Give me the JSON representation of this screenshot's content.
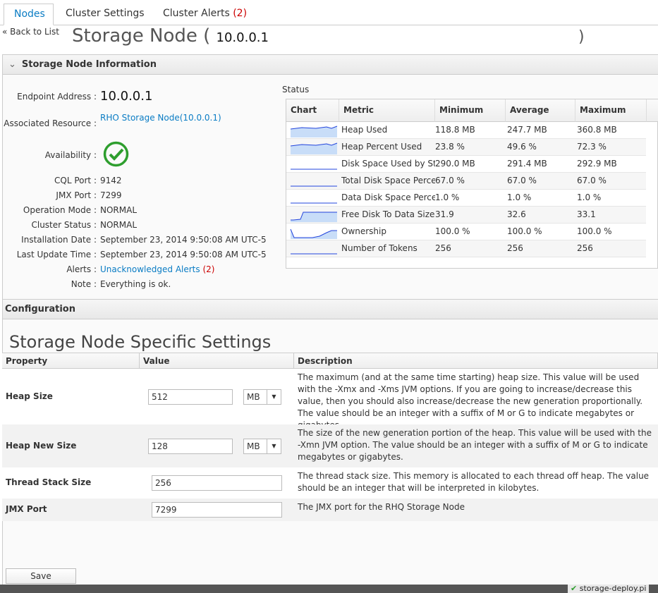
{
  "tabs": [
    {
      "label": "Nodes",
      "active": true
    },
    {
      "label": "Cluster Settings"
    },
    {
      "label": "Cluster Alerts",
      "count": "(2)"
    }
  ],
  "back_link": "« Back to List",
  "title": {
    "prefix": "Storage Node (",
    "address": "10.0.0.1",
    "suffix": ")"
  },
  "info_section": {
    "title": "Storage Node Information",
    "fields": {
      "endpoint_label": "Endpoint Address :",
      "endpoint": "10.0.0.1",
      "resource_label": "Associated Resource :",
      "resource": "RHO Storage Node(10.0.0.1)",
      "availability_label": "Availability :",
      "availability_icon": "check-circle-icon",
      "cql_label": "CQL Port :",
      "cql": "9142",
      "jmx_label": "JMX Port :",
      "jmx": "7299",
      "opmode_label": "Operation Mode :",
      "opmode": "NORMAL",
      "cstatus_label": "Cluster Status :",
      "cstatus": "NORMAL",
      "install_label": "Installation Date :",
      "install": "September 23, 2014 9:50:08 AM UTC-5",
      "update_label": "Last Update Time :",
      "update": "September 23, 2014 9:50:08 AM UTC-5",
      "alerts_label": "Alerts :",
      "alerts": "Unacknowledged Alerts",
      "alerts_count": "(2)",
      "note_label": "Note :",
      "note": "Everything is ok."
    }
  },
  "status": {
    "label": "Status",
    "columns": [
      "Chart",
      "Metric",
      "Minimum",
      "Average",
      "Maximum"
    ],
    "rows": [
      {
        "metric": "Heap Used",
        "min": "118.8 MB",
        "avg": "247.7 MB",
        "max": "360.8 MB"
      },
      {
        "metric": "Heap Percent Used",
        "min": "23.8 %",
        "avg": "49.6 %",
        "max": "72.3 %"
      },
      {
        "metric": "Disk Space Used by Stor",
        "min": "290.0 MB",
        "avg": "291.4 MB",
        "max": "292.9 MB"
      },
      {
        "metric": "Total Disk Space Percer",
        "min": "67.0 %",
        "avg": "67.0 %",
        "max": "67.0 %"
      },
      {
        "metric": "Data Disk Space Percen",
        "min": "1.0 %",
        "avg": "1.0 %",
        "max": "1.0 %"
      },
      {
        "metric": "Free Disk To Data Size F",
        "min": "31.9",
        "avg": "32.6",
        "max": "33.1"
      },
      {
        "metric": "Ownership",
        "min": "100.0 %",
        "avg": "100.0 %",
        "max": "100.0 %"
      },
      {
        "metric": "Number of Tokens",
        "min": "256",
        "avg": "256",
        "max": "256"
      }
    ]
  },
  "config": {
    "title": "Configuration",
    "subtitle": "Storage Node Specific Settings",
    "columns": [
      "Property",
      "Value",
      "Description"
    ],
    "rows": [
      {
        "property": "Heap Size",
        "value": "512",
        "unit": "MB",
        "description": "The maximum (and at the same time starting) heap size. This value will be used with the -Xmx and -Xms JVM options. If you are going to increase/decrease this value, then you should also increase/decrease the new generation proportionally. The value should be an integer with a suffix of M or G to indicate megabytes or gigabytes."
      },
      {
        "property": "Heap New Size",
        "value": "128",
        "unit": "MB",
        "description": "The size of the new generation portion of the heap. This value will be used with the -Xmn JVM option. The value should be an integer with a suffix of M or G to indicate megabytes or gigabytes."
      },
      {
        "property": "Thread Stack Size",
        "value": "256",
        "description": "The thread stack size. This memory is allocated to each thread off heap. The value should be an integer that will be interpreted in kilobytes."
      },
      {
        "property": "JMX Port",
        "value": "7299",
        "description": "The JMX port for the RHQ Storage Node"
      }
    ],
    "save_label": "Save"
  },
  "taskbar_text": "storage-deploy.pi",
  "colors": {
    "accent": "#0a7cc4",
    "alert": "#cc0000",
    "available": "#2e9e2e",
    "spark": "#2244dd",
    "spark_fill": "#c8ddf8"
  }
}
